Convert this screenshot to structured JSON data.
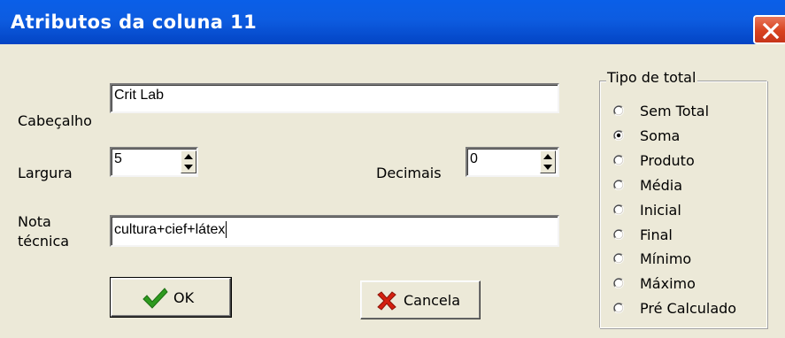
{
  "dialog": {
    "title": "Atributos da coluna 11"
  },
  "fields": {
    "cabecalho_label": "Cabeçalho",
    "cabecalho_value": "Crit Lab",
    "largura_label": "Largura",
    "largura_value": "5",
    "decimais_label": "Decimais",
    "decimais_value": "0",
    "nota_label_line1": "Nota",
    "nota_label_line2": "técnica",
    "nota_value": "cultura+cief+látex"
  },
  "tipo_total": {
    "legend": "Tipo de total",
    "selected": "Soma",
    "options": [
      {
        "label": "Sem Total",
        "checked": false
      },
      {
        "label": "Soma",
        "checked": true
      },
      {
        "label": "Produto",
        "checked": false
      },
      {
        "label": "Média",
        "checked": false
      },
      {
        "label": "Inicial",
        "checked": false
      },
      {
        "label": "Final",
        "checked": false
      },
      {
        "label": "Mínimo",
        "checked": false
      },
      {
        "label": "Máximo",
        "checked": false
      },
      {
        "label": "Pré Calculado",
        "checked": false
      }
    ]
  },
  "buttons": {
    "ok_label": "OK",
    "cancel_label": "Cancela"
  },
  "icons": {
    "close": "close-icon",
    "ok": "checkmark-icon",
    "cancel": "red-x-icon",
    "spin_up": "arrow-up-icon",
    "spin_down": "arrow-down-icon"
  },
  "colors": {
    "titlebar": "#0a5fe8",
    "close_button": "#d8431f",
    "dialog_background": "#ece9d8",
    "checkmark": "#2e9a1f",
    "cancel_x": "#d42010"
  }
}
